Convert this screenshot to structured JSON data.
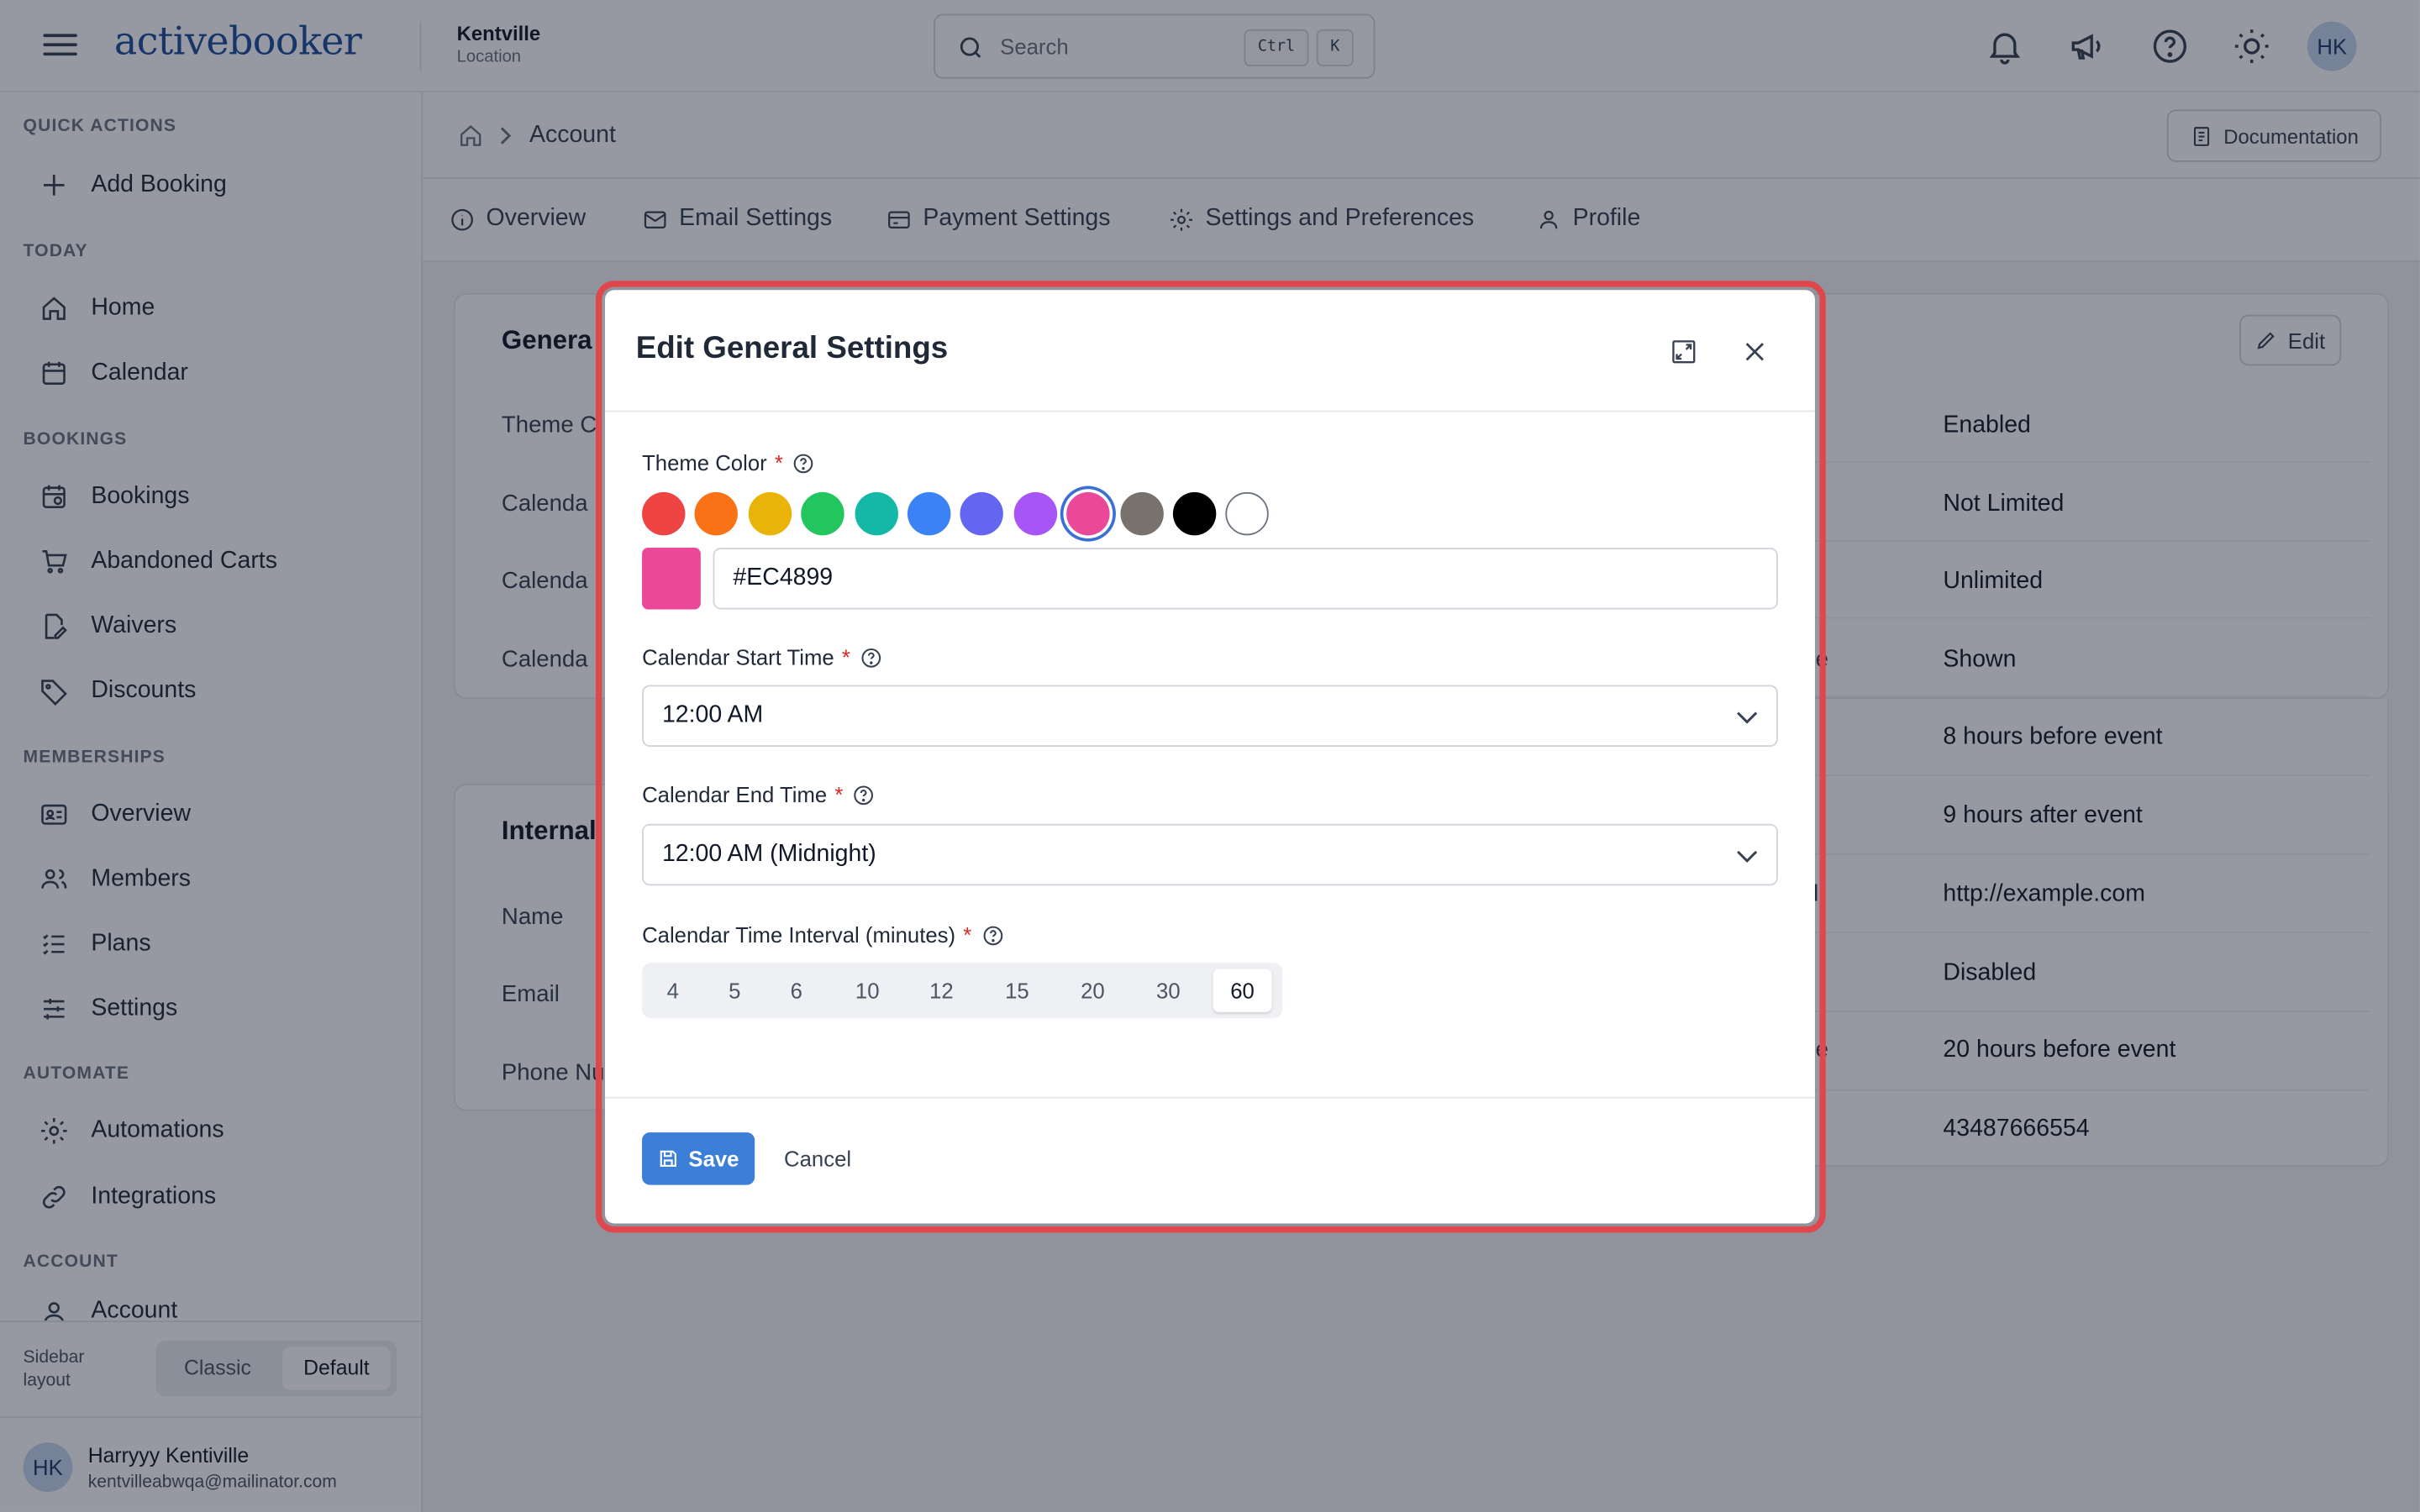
{
  "header": {
    "logo": "activebooker",
    "location_name": "Kentville",
    "location_sub": "Location",
    "search_placeholder": "Search",
    "kbd_ctrl": "Ctrl",
    "kbd_k": "K",
    "avatar": "HK"
  },
  "sidebar": {
    "quick_actions": "QUICK ACTIONS",
    "add_booking": "Add Booking",
    "today": "TODAY",
    "home": "Home",
    "calendar": "Calendar",
    "bookings_sec": "BOOKINGS",
    "bookings": "Bookings",
    "abandoned_carts": "Abandoned Carts",
    "waivers": "Waivers",
    "discounts": "Discounts",
    "memberships_sec": "MEMBERSHIPS",
    "overview": "Overview",
    "members": "Members",
    "plans": "Plans",
    "settings": "Settings",
    "automate_sec": "AUTOMATE",
    "automations": "Automations",
    "integrations": "Integrations",
    "account_sec": "ACCOUNT",
    "account": "Account",
    "layout_label": "Sidebar layout",
    "layout_classic": "Classic",
    "layout_default": "Default",
    "user_initials": "HK",
    "user_name": "Harryyy Kentiville",
    "user_email": "kentvilleabwqa@mailinator.com"
  },
  "main": {
    "breadcrumb": "Account",
    "documentation": "Documentation",
    "tabs": [
      "Overview",
      "Email Settings",
      "Payment Settings",
      "Settings and Preferences",
      "Profile"
    ],
    "general_title": "Genera",
    "edit": "Edit",
    "left_labels": [
      "Theme C",
      "Calenda",
      "Calenda",
      "Calenda"
    ],
    "right_partial": [
      "ge",
      "l.",
      "ge"
    ],
    "internal_title": "Internal",
    "internal_labels": [
      "Name",
      "Email",
      "Phone Nu"
    ],
    "values": [
      "Enabled",
      "Not Limited",
      "Unlimited",
      "Shown",
      "8 hours before event",
      "9 hours after event",
      "http://example.com",
      "Disabled",
      "20 hours before event",
      "43487666554"
    ]
  },
  "modal": {
    "title": "Edit General Settings",
    "theme_color_label": "Theme Color",
    "required_mark": "*",
    "theme_colors": [
      "#ef4444",
      "#f97316",
      "#eab308",
      "#22c55e",
      "#14b8a6",
      "#3b82f6",
      "#6366f1",
      "#a855f7",
      "#ec4899",
      "#78716c",
      "#000000",
      "#ffffff"
    ],
    "selected_color": "#EC4899",
    "start_label": "Calendar Start Time",
    "start_value": "12:00 AM",
    "end_label": "Calendar End Time",
    "end_value": "12:00 AM (Midnight)",
    "interval_label": "Calendar Time Interval (minutes)",
    "intervals": [
      "4",
      "5",
      "6",
      "10",
      "12",
      "15",
      "20",
      "30",
      "60"
    ],
    "interval_selected": "60",
    "save": "Save",
    "cancel": "Cancel"
  }
}
